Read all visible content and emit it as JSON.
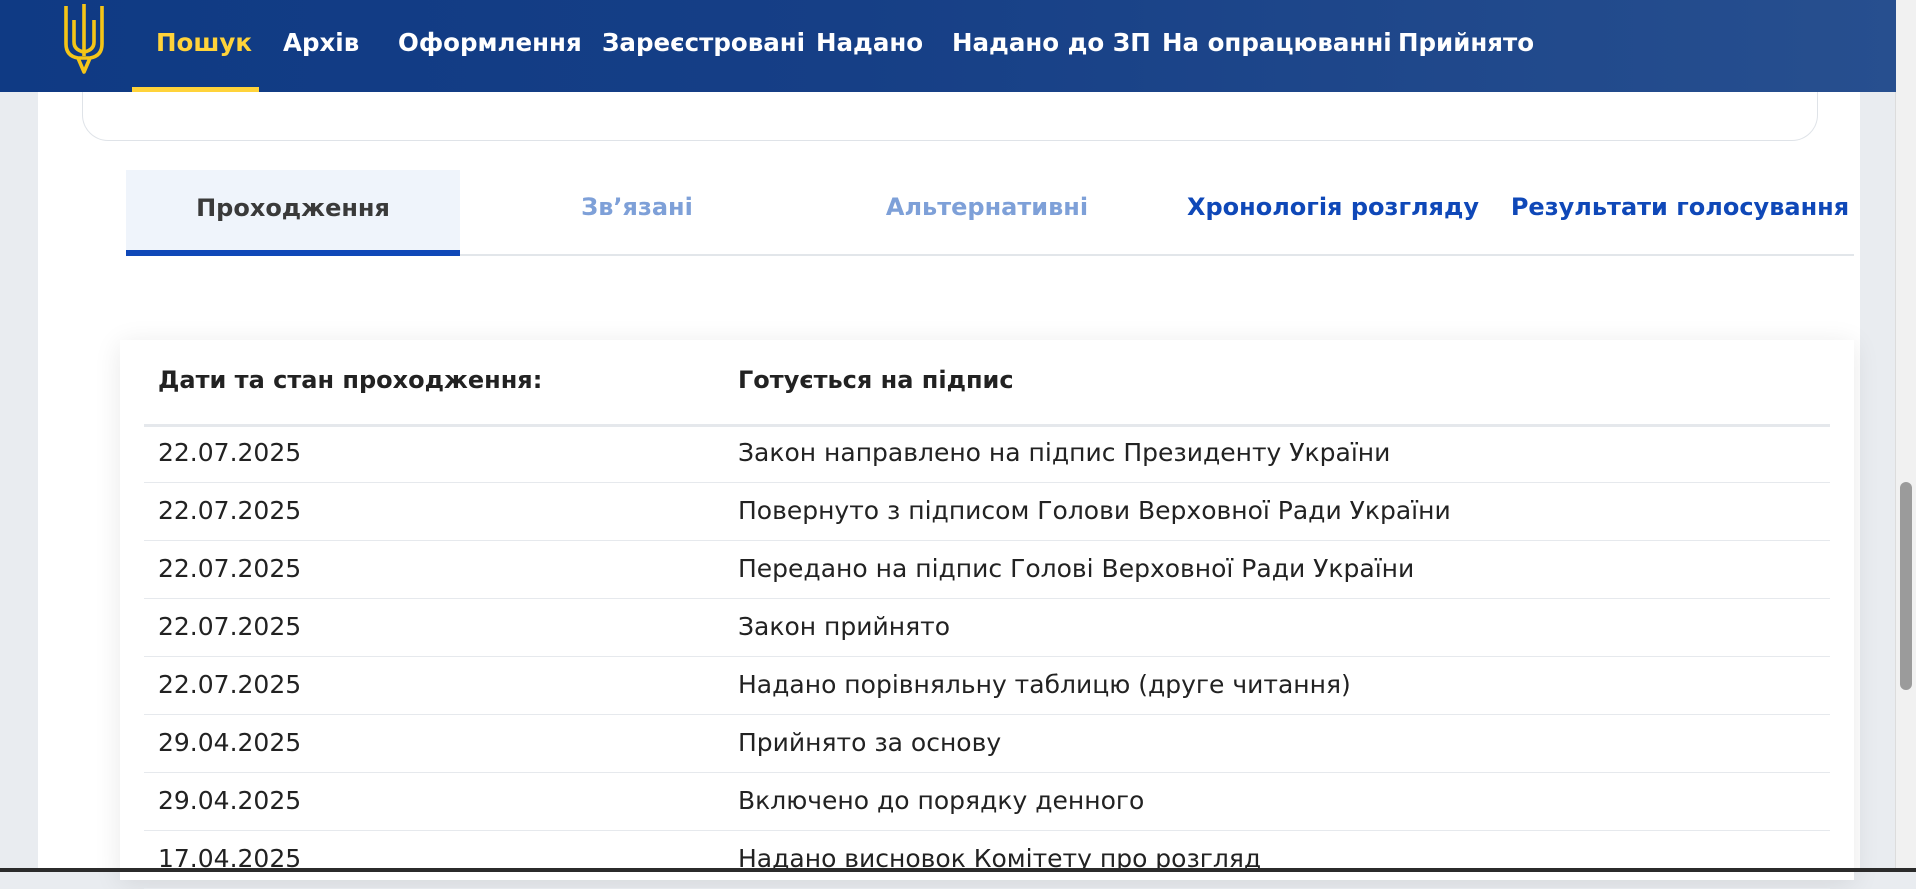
{
  "nav": {
    "items": [
      "Пошук",
      "Архів",
      "Оформлення",
      "Зареєстровані",
      "Надано",
      "Надано до ЗП",
      "На опрацюванні",
      "Прийнято"
    ],
    "active_index": 0,
    "colors": {
      "bar": "#163f86",
      "active": "#ffd33a",
      "text": "#ffffff"
    },
    "logo_icon": "trident-icon"
  },
  "tabs": {
    "items": [
      "Проходження",
      "Зв’язані",
      "Альтернативні",
      "Хронологія розгляду",
      "Результати голосування"
    ],
    "active_index": 0
  },
  "table": {
    "headers": [
      "Дати та стан проходження:",
      "Готується на підпис"
    ],
    "rows": [
      [
        "22.07.2025",
        "Закон направлено на підпис Президенту України"
      ],
      [
        "22.07.2025",
        "Повернуто з підписом Голови Верховної Ради України"
      ],
      [
        "22.07.2025",
        "Передано на підпис Голові Верховної Ради України"
      ],
      [
        "22.07.2025",
        "Закон прийнято"
      ],
      [
        "22.07.2025",
        "Надано порівняльну таблицю (друге читання)"
      ],
      [
        "29.04.2025",
        "Прийнято за основу"
      ],
      [
        "29.04.2025",
        "Включено до порядку денного"
      ],
      [
        "17.04.2025",
        "Надано висновок Комітету про розгляд"
      ]
    ]
  }
}
